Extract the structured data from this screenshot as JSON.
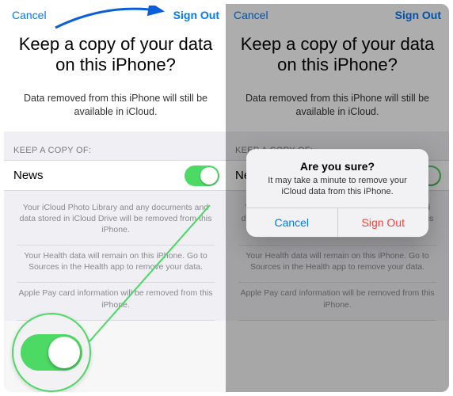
{
  "colors": {
    "ios_blue": "#007aff",
    "ios_green": "#4cd964",
    "ios_red": "#ff3b30",
    "ios_gray_text": "#8a8a8f"
  },
  "left": {
    "nav_cancel": "Cancel",
    "nav_signout": "Sign Out",
    "title": "Keep a copy of your data on this iPhone?",
    "subtitle": "Data removed from this iPhone will still be available in iCloud.",
    "section_label": "KEEP A COPY OF:",
    "row": {
      "label": "News",
      "toggle_on": true
    },
    "footer": {
      "p1": "Your iCloud Photo Library and any documents and data stored in iCloud Drive will be removed from this iPhone.",
      "p2": "Your Health data will remain on this iPhone. Go to Sources in the Health app to remove your data.",
      "p3": "Apple Pay card information will be removed from this iPhone."
    }
  },
  "right": {
    "nav_cancel": "Cancel",
    "nav_signout": "Sign Out",
    "title": "Keep a copy of your data on this iPhone?",
    "subtitle": "Data removed from this iPhone will still be available in iCloud.",
    "section_label": "KEEP A COPY OF:",
    "row": {
      "label": "News",
      "toggle_on": true
    },
    "footer": {
      "p1": "Your iCloud Photo Library and any documents and data stored in iCloud Drive will be removed from this iPhone.",
      "p2": "Your Health data will remain on this iPhone. Go to Sources in the Health app to remove your data.",
      "p3": "Apple Pay card information will be removed from this iPhone."
    },
    "alert": {
      "title": "Are you sure?",
      "message": "It may take a minute to remove your iCloud data from this iPhone.",
      "cancel": "Cancel",
      "confirm": "Sign Out"
    }
  }
}
